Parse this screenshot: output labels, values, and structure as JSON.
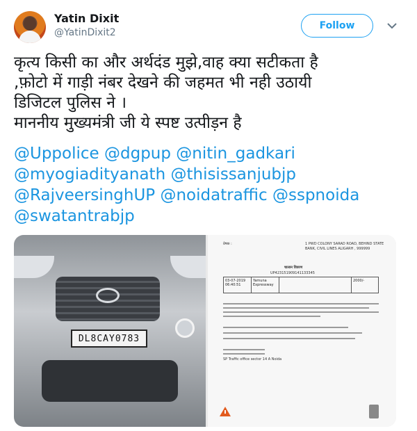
{
  "author": {
    "name": "Yatin Dixit",
    "handle": "@YatinDixit2"
  },
  "follow_label": "Follow",
  "tweet_lines": [
    "कृत्य किसी का और अर्थदंड मुझे,वाह क्या सटीकता है",
    ",फ़ोटो में गाड़ी नंबर देखने की जहमत भी नही उठायी",
    "डिजिटल पुलिस ने ।",
    "माननीय मुख्यमंत्री जी ये स्पष्ट उत्पीड़न है"
  ],
  "mentions": [
    "@Uppolice",
    "@dgpup",
    "@nitin_gadkari",
    "@myogiadityanath",
    "@thisissanjubjp",
    "@RajveersinghUP",
    "@noidatraffic",
    "@sspnoida",
    "@swatantrabjp"
  ],
  "media": {
    "car_plate": "DL8CAY0783",
    "doc_header_left": "प्रेषक :",
    "doc_header_right": "1 PWD COLONY SARAD ROAD, BEHIND STATE BANK, CIVIL LINES ALIGARH , 999999",
    "doc_title": "चालान विवरण",
    "doc_challan_id": "UP423151909141133345",
    "doc_date": "03-07-2019 06:40:51",
    "doc_place": "Yamuna Expressway",
    "doc_amount": "2000/-",
    "doc_footer": "SP Traffic office sector 14 A Noida"
  },
  "colors": {
    "accent": "#1da1f2",
    "mention": "#1b95e0",
    "text": "#14171a",
    "muted": "#657786"
  }
}
